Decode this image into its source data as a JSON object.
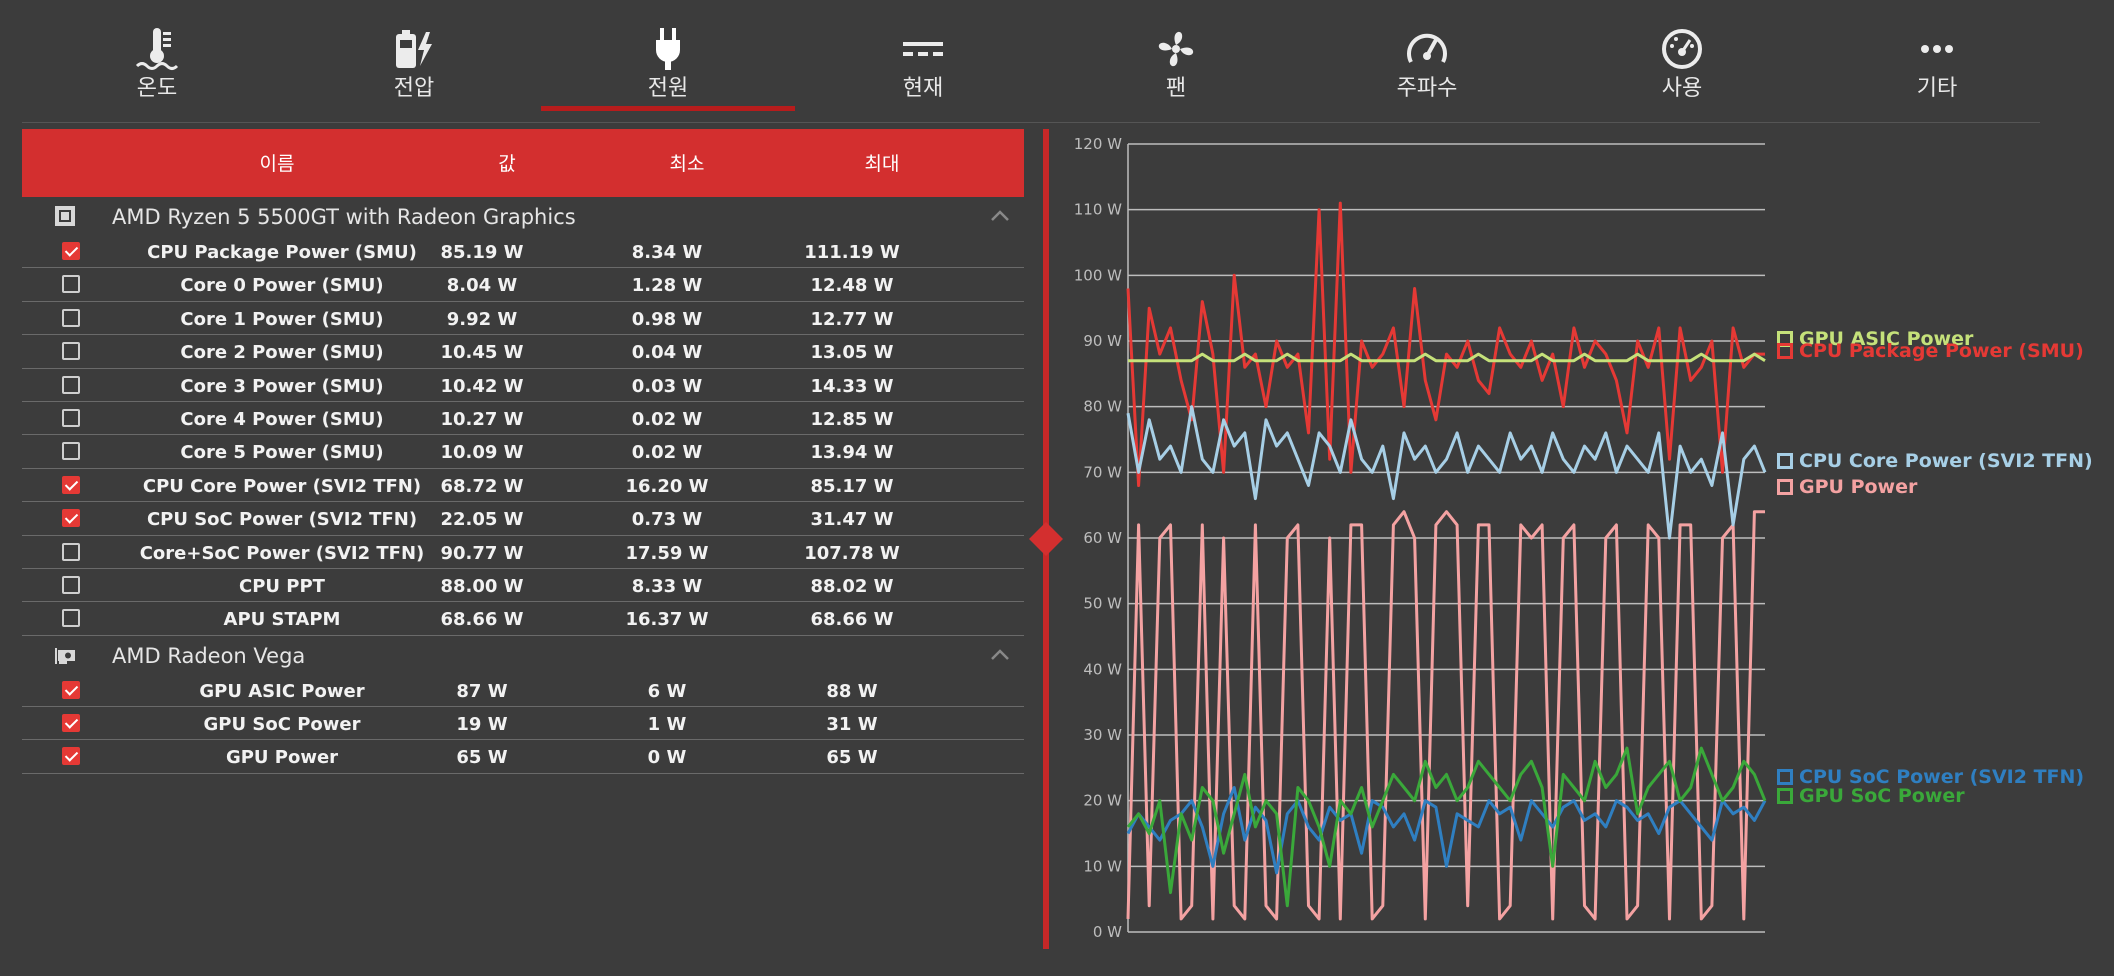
{
  "tabs": [
    {
      "label": "온도",
      "icon": "thermometer-icon",
      "active": false
    },
    {
      "label": "전압",
      "icon": "battery-bolt-icon",
      "active": false
    },
    {
      "label": "전원",
      "icon": "plug-icon",
      "active": true
    },
    {
      "label": "현재",
      "icon": "dc-current-icon",
      "active": false
    },
    {
      "label": "팬",
      "icon": "fan-icon",
      "active": false
    },
    {
      "label": "주파수",
      "icon": "speedometer-icon",
      "active": false
    },
    {
      "label": "사용",
      "icon": "gauge-icon",
      "active": false
    },
    {
      "label": "기타",
      "icon": "more-dots-icon",
      "active": false
    }
  ],
  "table": {
    "headers": {
      "name": "이름",
      "value": "값",
      "min": "최소",
      "max": "최대"
    },
    "groups": [
      {
        "name": "AMD Ryzen 5 5500GT with Radeon Graphics",
        "icon": "cpu-chip-icon",
        "rows": [
          {
            "name": "CPU Package Power (SMU)",
            "value": "85.19 W",
            "min": "8.34 W",
            "max": "111.19 W",
            "checked": true
          },
          {
            "name": "Core 0 Power (SMU)",
            "value": "8.04 W",
            "min": "1.28 W",
            "max": "12.48 W",
            "checked": false
          },
          {
            "name": "Core 1 Power (SMU)",
            "value": "9.92 W",
            "min": "0.98 W",
            "max": "12.77 W",
            "checked": false
          },
          {
            "name": "Core 2 Power (SMU)",
            "value": "10.45 W",
            "min": "0.04 W",
            "max": "13.05 W",
            "checked": false
          },
          {
            "name": "Core 3 Power (SMU)",
            "value": "10.42 W",
            "min": "0.03 W",
            "max": "14.33 W",
            "checked": false
          },
          {
            "name": "Core 4 Power (SMU)",
            "value": "10.27 W",
            "min": "0.02 W",
            "max": "12.85 W",
            "checked": false
          },
          {
            "name": "Core 5 Power (SMU)",
            "value": "10.09 W",
            "min": "0.02 W",
            "max": "13.94 W",
            "checked": false
          },
          {
            "name": "CPU Core Power (SVI2 TFN)",
            "value": "68.72 W",
            "min": "16.20 W",
            "max": "85.17 W",
            "checked": true
          },
          {
            "name": "CPU SoC Power (SVI2 TFN)",
            "value": "22.05 W",
            "min": "0.73 W",
            "max": "31.47 W",
            "checked": true
          },
          {
            "name": "Core+SoC Power (SVI2 TFN)",
            "value": "90.77 W",
            "min": "17.59 W",
            "max": "107.78 W",
            "checked": false
          },
          {
            "name": "CPU PPT",
            "value": "88.00 W",
            "min": "8.33 W",
            "max": "88.02 W",
            "checked": false
          },
          {
            "name": "APU STAPM",
            "value": "68.66 W",
            "min": "16.37 W",
            "max": "68.66 W",
            "checked": false
          }
        ]
      },
      {
        "name": "AMD Radeon Vega",
        "icon": "gpu-card-icon",
        "rows": [
          {
            "name": "GPU ASIC Power",
            "value": "87 W",
            "min": "6 W",
            "max": "88 W",
            "checked": true
          },
          {
            "name": "GPU SoC Power",
            "value": "19 W",
            "min": "1 W",
            "max": "31 W",
            "checked": true
          },
          {
            "name": "GPU Power",
            "value": "65 W",
            "min": "0 W",
            "max": "65 W",
            "checked": true
          }
        ]
      }
    ]
  },
  "chart_data": {
    "type": "line",
    "ylim": [
      0,
      120
    ],
    "yticks": [
      "0 W",
      "10 W",
      "20 W",
      "30 W",
      "40 W",
      "50 W",
      "60 W",
      "70 W",
      "80 W",
      "90 W",
      "100 W",
      "110 W",
      "120 W"
    ],
    "grid": true,
    "legend_position": "right",
    "series": [
      {
        "name": "GPU ASIC Power",
        "color": "#c5e17a",
        "icon": "gpu-card-icon",
        "values": [
          87,
          87,
          87,
          87,
          87,
          87,
          87,
          88,
          87,
          87,
          87,
          88,
          87,
          87,
          87,
          88,
          87,
          87,
          87,
          87,
          87,
          88,
          87,
          87,
          87,
          87,
          87,
          87,
          88,
          87,
          87,
          87,
          87,
          88,
          87,
          87,
          87,
          87,
          87,
          88,
          87,
          87,
          87,
          88,
          87,
          87,
          87,
          87,
          88,
          87,
          87,
          87,
          87,
          87,
          88,
          87,
          87,
          87,
          87,
          88,
          87
        ]
      },
      {
        "name": "CPU Package Power (SMU)",
        "color": "#e53935",
        "icon": "cpu-chip-icon",
        "values": [
          98,
          68,
          95,
          88,
          92,
          84,
          78,
          96,
          88,
          70,
          100,
          86,
          88,
          80,
          90,
          86,
          88,
          76,
          110,
          72,
          111,
          70,
          90,
          86,
          88,
          92,
          80,
          98,
          84,
          78,
          88,
          86,
          90,
          84,
          82,
          92,
          88,
          86,
          90,
          84,
          88,
          80,
          92,
          86,
          90,
          88,
          84,
          76,
          90,
          86,
          92,
          72,
          92,
          84,
          86,
          90,
          70,
          92,
          86,
          88,
          88
        ]
      },
      {
        "name": "CPU Core Power (SVI2 TFN)",
        "color": "#a7cfe6",
        "icon": "cpu-chip-icon",
        "values": [
          79,
          70,
          78,
          72,
          74,
          70,
          80,
          72,
          70,
          78,
          74,
          76,
          66,
          78,
          74,
          76,
          72,
          68,
          76,
          74,
          70,
          78,
          72,
          70,
          74,
          66,
          76,
          72,
          74,
          70,
          72,
          76,
          70,
          74,
          72,
          70,
          76,
          72,
          74,
          70,
          76,
          72,
          70,
          74,
          72,
          76,
          70,
          74,
          72,
          70,
          76,
          60,
          74,
          70,
          72,
          68,
          76,
          62,
          72,
          74,
          70
        ]
      },
      {
        "name": "GPU Power",
        "color": "#f4a2a2",
        "icon": "gpu-card-icon",
        "values": [
          2,
          62,
          4,
          60,
          62,
          2,
          4,
          62,
          2,
          60,
          4,
          2,
          62,
          4,
          2,
          60,
          62,
          4,
          2,
          60,
          2,
          62,
          62,
          2,
          4,
          62,
          64,
          60,
          2,
          62,
          64,
          62,
          4,
          62,
          62,
          2,
          4,
          62,
          60,
          62,
          2,
          60,
          62,
          4,
          2,
          60,
          62,
          2,
          4,
          62,
          60,
          2,
          62,
          62,
          2,
          4,
          60,
          62,
          2,
          64,
          64
        ]
      },
      {
        "name": "CPU SoC Power (SVI2 TFN)",
        "color": "#2f7fc1",
        "icon": "cpu-chip-icon",
        "values": [
          15,
          18,
          16,
          14,
          17,
          18,
          20,
          16,
          10,
          18,
          22,
          14,
          19,
          17,
          9,
          18,
          20,
          16,
          14,
          19,
          17,
          18,
          12,
          20,
          19,
          16,
          18,
          14,
          20,
          19,
          10,
          18,
          17,
          16,
          20,
          18,
          19,
          14,
          20,
          18,
          16,
          19,
          20,
          17,
          18,
          16,
          20,
          19,
          17,
          18,
          15,
          19,
          20,
          18,
          16,
          14,
          20,
          18,
          19,
          17,
          20
        ]
      },
      {
        "name": "GPU SoC Power",
        "color": "#3aa83a",
        "icon": "gpu-card-icon",
        "values": [
          16,
          18,
          15,
          20,
          6,
          18,
          14,
          22,
          20,
          12,
          18,
          24,
          16,
          20,
          18,
          4,
          22,
          20,
          16,
          10,
          20,
          18,
          22,
          16,
          20,
          24,
          22,
          20,
          26,
          22,
          24,
          20,
          22,
          26,
          24,
          22,
          20,
          24,
          26,
          22,
          10,
          24,
          22,
          20,
          26,
          22,
          24,
          28,
          18,
          22,
          24,
          26,
          20,
          22,
          28,
          24,
          20,
          22,
          26,
          24,
          20
        ]
      }
    ]
  }
}
